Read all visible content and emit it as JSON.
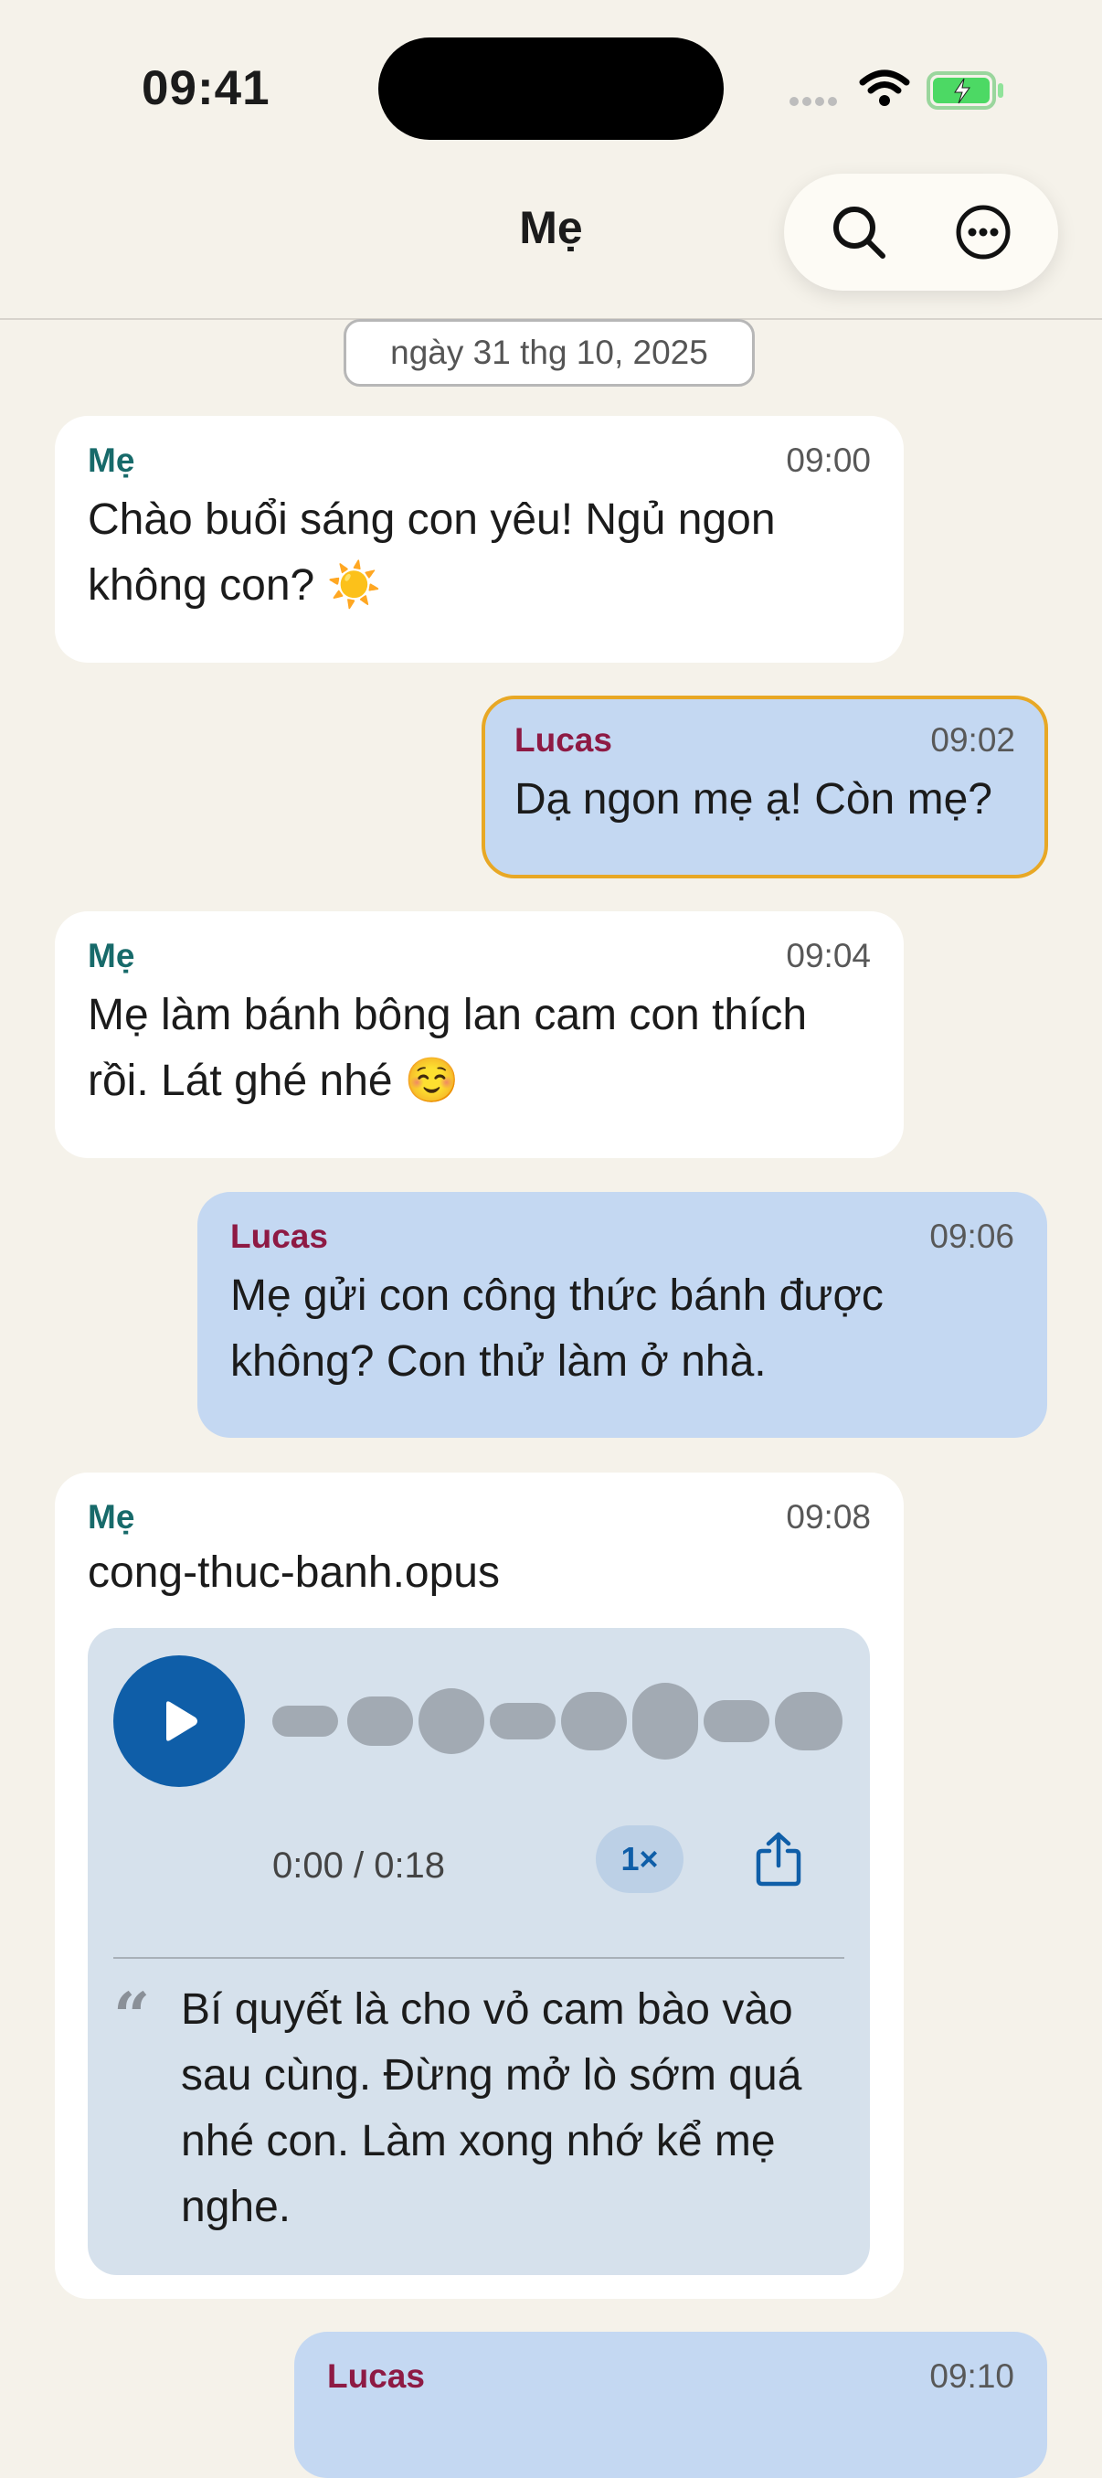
{
  "status": {
    "time": "09:41"
  },
  "chat": {
    "title": "Mẹ"
  },
  "date_divider": "ngày 31 thg 10, 2025",
  "messages": [
    {
      "sender": "Mẹ",
      "time": "09:00",
      "text_lines": [
        "Chào buổi sáng con yêu! Ngủ ngon",
        "không con? ☀️"
      ]
    },
    {
      "sender": "Lucas",
      "time": "09:02",
      "text_lines": [
        "Dạ ngon mẹ ạ! Còn mẹ?"
      ],
      "selected": true
    },
    {
      "sender": "Mẹ",
      "time": "09:04",
      "text_lines": [
        "Mẹ làm bánh bông lan cam con thích",
        "rồi. Lát ghé nhé ☺️"
      ]
    },
    {
      "sender": "Lucas",
      "time": "09:06",
      "text_lines": [
        "Mẹ gửi con công thức bánh được",
        "không? Con thử làm ở nhà."
      ]
    },
    {
      "sender": "Mẹ",
      "time": "09:08",
      "file_name": "cong-thuc-banh.opus",
      "audio": {
        "duration_text": "0:00 / 0:18",
        "progress": 0,
        "speed": "1×",
        "transcript_lines": [
          "Bí quyết là cho vỏ cam bào vào",
          "sau cùng. Đừng mở lò sớm quá",
          "nhé con. Làm xong nhớ kể mẹ",
          "nghe."
        ]
      }
    },
    {
      "sender": "Lucas",
      "time": "09:10"
    }
  ],
  "colors": {
    "background": "#f5f2ea",
    "incoming_bubble": "#ffffff",
    "outgoing_bubble": "#c4d8f2",
    "selected_outline": "#e8a825",
    "mom_name": "#176a6a",
    "lucas_name": "#8e1a44",
    "play_button": "#0f5ea8"
  },
  "icons": [
    "search-icon",
    "more-icon",
    "play-icon",
    "share-icon",
    "wifi-icon",
    "battery-charging-icon"
  ]
}
